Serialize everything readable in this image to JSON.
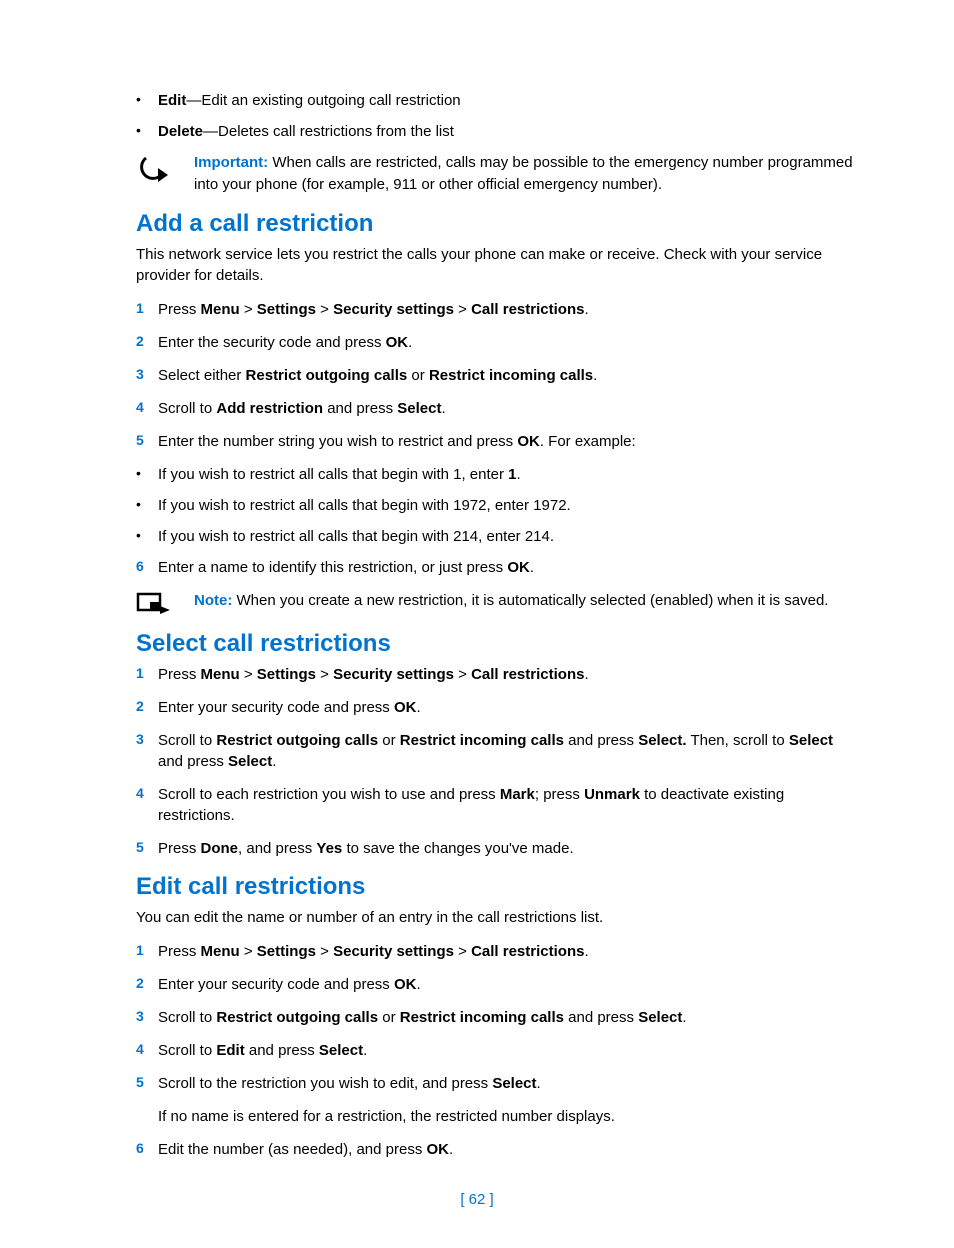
{
  "top_bullets": [
    {
      "term": "Edit",
      "rest": "—Edit an existing outgoing call restriction"
    },
    {
      "term": "Delete",
      "rest": "—Deletes call restrictions from the list"
    }
  ],
  "important": {
    "label": "Important:",
    "text": "When calls are restricted, calls may be possible to the emergency number programmed into your phone (for example, 911 or other official emergency number)."
  },
  "s1": {
    "heading": "Add a call restriction",
    "intro": "This network service lets you restrict the calls your phone can make or receive. Check with your service provider for details.",
    "steps": [
      {
        "pre": "Press ",
        "bolds": [
          "Menu",
          "Settings",
          "Security settings",
          "Call restrictions"
        ],
        "sep": " > ",
        "post": "."
      },
      {
        "raw": "Enter the security code and press <b>OK</b>."
      },
      {
        "raw": "Select either <b>Restrict outgoing calls</b> or <b>Restrict incoming calls</b>."
      },
      {
        "raw": "Scroll to <b>Add restriction</b> and press <b>Select</b>."
      },
      {
        "raw": "Enter the number string you wish to restrict and press <b>OK</b>. For example:"
      }
    ],
    "examples": [
      "If you wish to restrict all calls that begin with 1, enter <b>1</b>.",
      "If you wish to restrict all calls that begin with 1972, enter 1972.",
      "If you wish to restrict all calls that begin with 214, enter 214."
    ],
    "step6": "Enter a name to identify this restriction, or just press <b>OK</b>.",
    "note": {
      "label": "Note:",
      "text": "When you create a new restriction, it is automatically selected (enabled) when it is saved."
    }
  },
  "s2": {
    "heading": "Select call restrictions",
    "steps": [
      "Press <b>Menu</b> > <b>Settings</b> > <b>Security settings</b> > <b>Call restrictions</b>.",
      "Enter your security code and press <b>OK</b>.",
      "Scroll to <b>Restrict outgoing calls</b> or <b>Restrict incoming calls</b> and press <b>Select.</b> Then, scroll to <b>Select</b> and press <b>Select</b>.",
      "Scroll to each restriction you wish to use and press <b>Mark</b>; press <b>Unmark</b> to deactivate existing restrictions.",
      "Press <b>Done</b>, and press <b>Yes</b> to save the changes you've made."
    ]
  },
  "s3": {
    "heading": "Edit call restrictions",
    "intro": "You can edit the name or number of an entry in the call restrictions list.",
    "steps": [
      "Press <b>Menu</b> > <b>Settings</b> > <b>Security settings</b> > <b>Call restrictions</b>.",
      "Enter your security code and press <b>OK</b>.",
      "Scroll to <b>Restrict outgoing calls</b> or <b>Restrict incoming calls</b> and press <b>Select</b>.",
      "Scroll to <b>Edit</b> and press <b>Select</b>.",
      "Scroll to the restriction you wish to edit, and press <b>Select</b>."
    ],
    "sub_note": "If no name is entered for a restriction, the restricted number displays.",
    "step6": "Edit the number (as needed), and press <b>OK</b>."
  },
  "page_number": "[ 62 ]"
}
